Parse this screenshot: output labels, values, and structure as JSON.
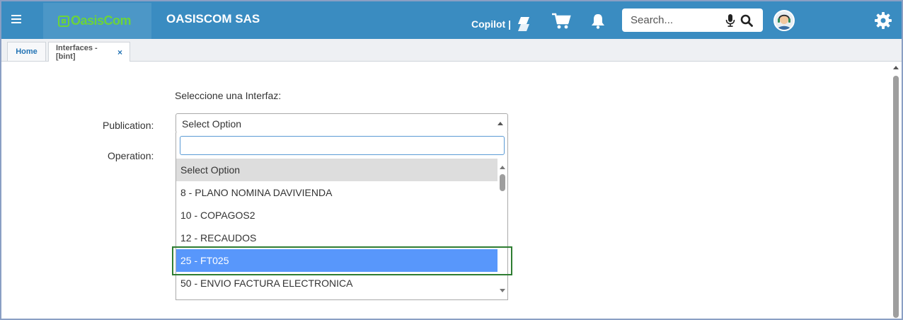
{
  "header": {
    "company_name": "OASISCOM SAS",
    "logo_text": "OasisCom",
    "copilot_label": "Copilot |",
    "search_placeholder": "Search..."
  },
  "tabs": [
    {
      "label": "Home"
    },
    {
      "label": "Interfaces -[bint]",
      "close": "×"
    }
  ],
  "form": {
    "intro": "Seleccione una Interfaz:",
    "publication_label": "Publication:",
    "operation_label": "Operation:",
    "publication_value": "Select Option",
    "dropdown_search_value": "",
    "options": [
      "Select Option",
      "8 - PLANO NOMINA DAVIVIENDA",
      "10 - COPAGOS2",
      "12 - RECAUDOS",
      "25 - FT025",
      "50 - ENVIO FACTURA ELECTRONICA"
    ],
    "highlighted_option": "25 - FT025"
  },
  "colors": {
    "topbar": "#3a8cc1",
    "logo_green": "#6cd43a",
    "highlight": "#5897fb",
    "focus_box": "#2e7d32"
  },
  "icons": [
    "menu-icon",
    "copilot-icon",
    "cart-icon",
    "bell-icon",
    "microphone-icon",
    "search-icon",
    "support-avatar-icon",
    "gear-icon"
  ]
}
